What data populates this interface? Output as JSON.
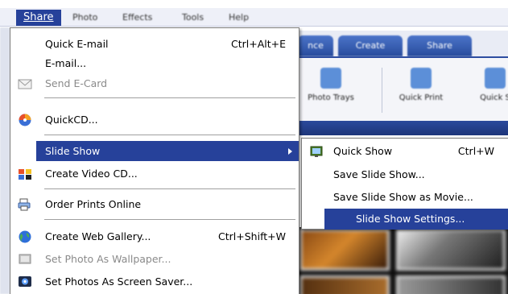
{
  "menubar": {
    "items": [
      {
        "label": "Share"
      },
      {
        "label": "Photo"
      },
      {
        "label": "Effects"
      },
      {
        "label": "Tools"
      },
      {
        "label": "Help"
      }
    ]
  },
  "tabs": {
    "enhance": "nce",
    "create": "Create",
    "share": "Share"
  },
  "toolbar": {
    "photo_trays": "Photo Trays",
    "quick_print": "Quick Print",
    "quick_more": "Quick S"
  },
  "share_menu": {
    "quick_email": {
      "label": "Quick E-mail",
      "shortcut": "Ctrl+Alt+E",
      "icon": "none"
    },
    "email": {
      "label": "E-mail...",
      "icon": "none"
    },
    "send_ecard": {
      "label": "Send E-Card",
      "icon": "envelope-icon",
      "disabled": true
    },
    "quickcd": {
      "label": "QuickCD...",
      "icon": "cd-icon"
    },
    "slide_show": {
      "label": "Slide Show",
      "icon": "none",
      "highlighted": true
    },
    "create_video_cd": {
      "label": "Create Video CD...",
      "icon": "film-icon"
    },
    "order_prints": {
      "label": "Order Prints Online",
      "icon": "print-order-icon"
    },
    "create_web_gallery": {
      "label": "Create Web Gallery...",
      "shortcut": "Ctrl+Shift+W",
      "icon": "globe-icon"
    },
    "set_wallpaper": {
      "label": "Set Photo As Wallpaper...",
      "icon": "wallpaper-icon",
      "disabled": true
    },
    "set_screensaver": {
      "label": "Set Photos As Screen Saver...",
      "icon": "screensaver-icon"
    }
  },
  "slideshow_submenu": {
    "quick_show": {
      "label": "Quick Show",
      "shortcut": "Ctrl+W",
      "icon": "slideshow-icon"
    },
    "save_slide_show": {
      "label": "Save Slide Show..."
    },
    "save_as_movie": {
      "label": "Save Slide Show as Movie..."
    },
    "settings": {
      "label": "Slide Show Settings...",
      "highlighted": true
    }
  },
  "colors": {
    "highlight": "#26419a",
    "disabled_text": "#8a8a8a",
    "tab_blue": "#274b9c"
  }
}
